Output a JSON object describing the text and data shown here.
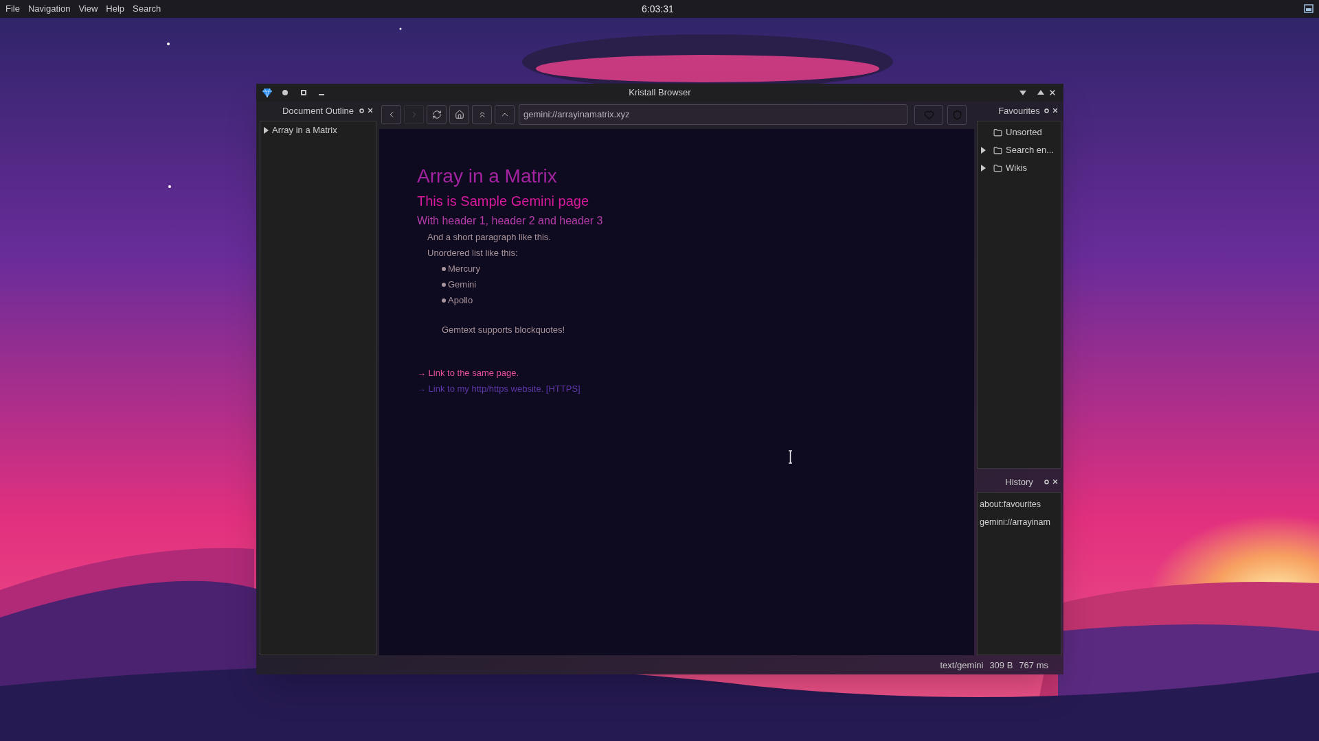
{
  "menu_bar": {
    "menus": [
      "File",
      "Navigation",
      "View",
      "Help",
      "Search"
    ],
    "clock": "6:03:31"
  },
  "window": {
    "title": "Kristall Browser"
  },
  "outline": {
    "title": "Document Outline",
    "items": [
      {
        "label": "Array in a Matrix",
        "expanded": false
      }
    ]
  },
  "toolbar": {
    "buttons": [
      {
        "kind": "back",
        "disabled": false
      },
      {
        "kind": "forward",
        "disabled": true
      },
      {
        "kind": "reload",
        "disabled": false
      },
      {
        "kind": "home",
        "disabled": false
      },
      {
        "kind": "root",
        "disabled": false
      },
      {
        "kind": "parent",
        "disabled": false
      }
    ],
    "address": "gemini://arrayinamatrix.xyz"
  },
  "page": {
    "blocks": [
      {
        "kind": "h1",
        "text": "Array in a Matrix"
      },
      {
        "kind": "h2",
        "text": "This is Sample Gemini page"
      },
      {
        "kind": "h3",
        "text": "With header 1, header 2 and header 3"
      },
      {
        "kind": "paragraph",
        "text": "And a short paragraph like this."
      },
      {
        "kind": "paragraph",
        "text": "Unordered list like this:"
      },
      {
        "kind": "list_item",
        "text": "Mercury"
      },
      {
        "kind": "list_item",
        "text": "Gemini"
      },
      {
        "kind": "list_item",
        "text": "Apollo"
      },
      {
        "kind": "blockquote",
        "text": "Gemtext supports blockquotes!"
      },
      {
        "kind": "link",
        "text": "→ Link to the same page."
      },
      {
        "kind": "external_link",
        "text": "→ Link to my http/https website. [HTTPS]"
      }
    ]
  },
  "favourites": {
    "title": "Favourites",
    "items": [
      {
        "label": "Unsorted",
        "has_children": false
      },
      {
        "label": "Search en...",
        "has_children": true
      },
      {
        "label": "Wikis",
        "has_children": true
      }
    ]
  },
  "history": {
    "title": "History",
    "items": [
      "about:favourites",
      "gemini://arrayinam"
    ]
  },
  "status_bar": {
    "mime": "text/gemini",
    "size": "309 B",
    "time": "767 ms"
  }
}
